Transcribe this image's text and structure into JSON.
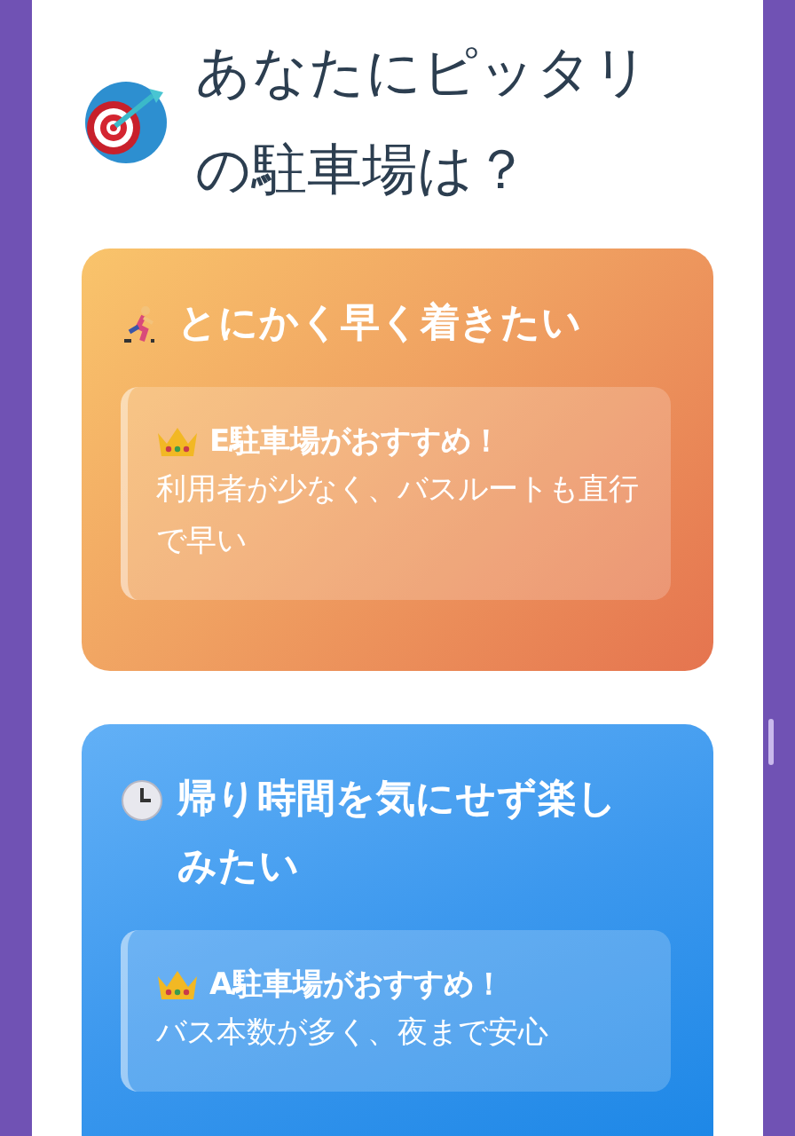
{
  "title": "あなたにピッタリの駐車場は？",
  "cards": [
    {
      "kind": "speed",
      "heading": "とにかく早く着きたい",
      "pick": "E駐車場がおすすめ！",
      "reason": "利用者が少なく、バスルートも直行で早い"
    },
    {
      "kind": "time",
      "heading": "帰り時間を気にせず楽しみたい",
      "pick": "A駐車場がおすすめ！",
      "reason": "バス本数が多く、夜まで安心"
    }
  ]
}
